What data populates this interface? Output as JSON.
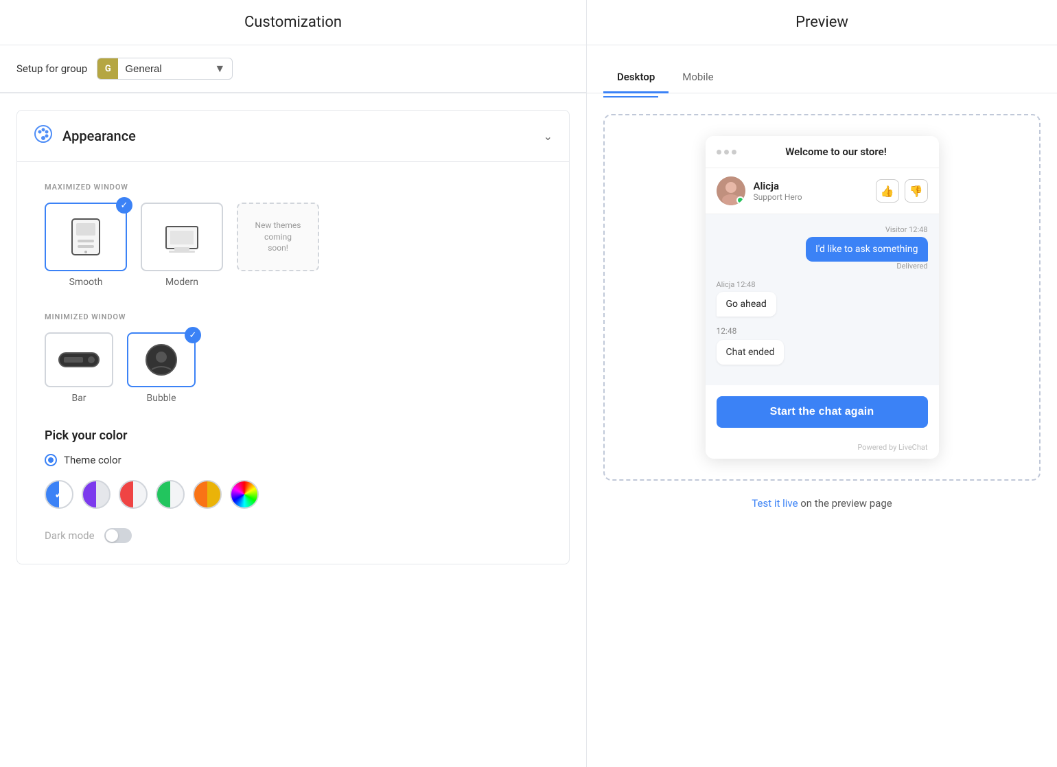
{
  "page": {
    "left_title": "Customization",
    "right_title": "Preview"
  },
  "setup": {
    "label": "Setup for group",
    "group_icon": "G",
    "group_name": "General"
  },
  "appearance": {
    "title": "Appearance",
    "maximized_label": "MAXIMIZED WINDOW",
    "minimized_label": "MINIMIZED WINDOW",
    "maximized_themes": [
      {
        "name": "Smooth",
        "selected": true
      },
      {
        "name": "Modern",
        "selected": false
      },
      {
        "name": "New themes\ncoming\nsoon!",
        "selected": false,
        "dashed": true
      }
    ],
    "minimized_themes": [
      {
        "name": "Bar",
        "selected": false
      },
      {
        "name": "Bubble",
        "selected": true
      }
    ],
    "color_section_title": "Pick your color",
    "color_options": [
      {
        "label": "Theme color",
        "selected": true
      }
    ],
    "dark_mode_label": "Dark mode"
  },
  "preview": {
    "tabs": [
      {
        "label": "Desktop",
        "active": true
      },
      {
        "label": "Mobile",
        "active": false
      }
    ],
    "chat": {
      "welcome_text": "Welcome to our store!",
      "agent_name": "Alicja",
      "agent_role": "Support Hero",
      "messages": [
        {
          "sender": "visitor",
          "time": "Visitor 12:48",
          "text": "I'd like to ask something",
          "delivered": "Delivered"
        },
        {
          "sender": "agent",
          "time": "Alicja 12:48",
          "text": "Go ahead"
        },
        {
          "sender": "system",
          "time": "12:48",
          "text": "Chat ended"
        }
      ],
      "cta_button": "Start the chat again",
      "powered_by": "Powered by LiveChat"
    },
    "test_live_prefix": "Test it live",
    "test_live_suffix": " on the preview page"
  }
}
